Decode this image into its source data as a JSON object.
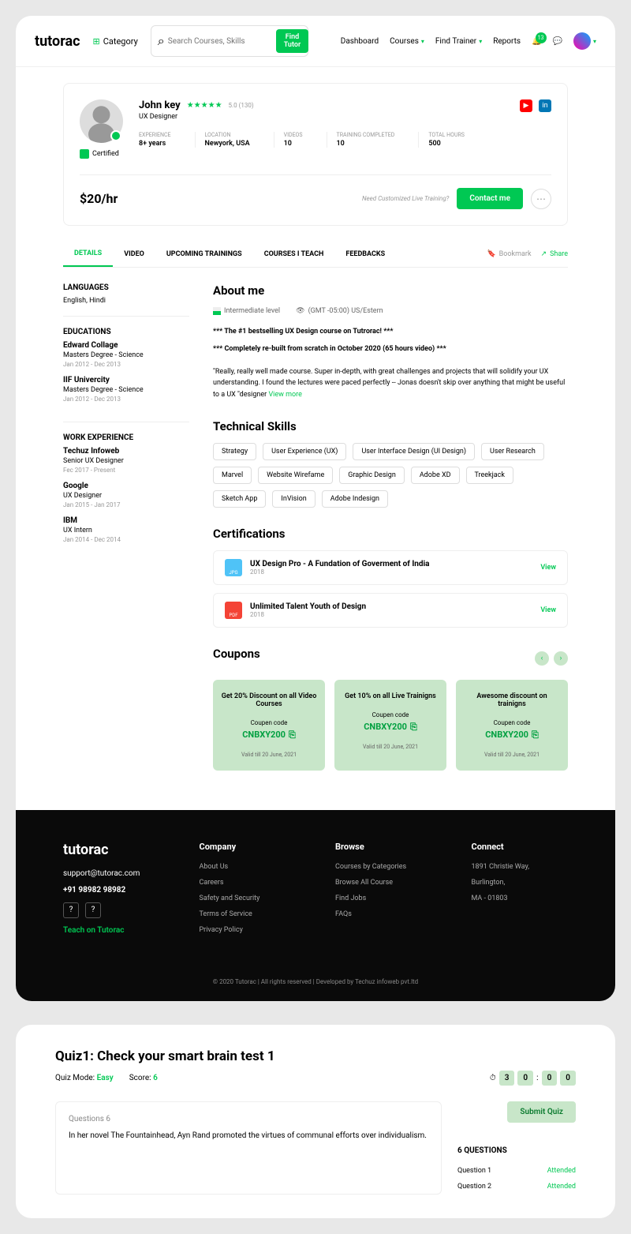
{
  "header": {
    "logo": "tutorac",
    "category": "Category",
    "search_placeholder": "Search Courses, Skills",
    "find_tutor": "Find Tutor",
    "nav": [
      "Dashboard",
      "Courses",
      "Find Trainer",
      "Reports"
    ],
    "notif_count": "13"
  },
  "profile": {
    "name": "John key",
    "rating": "5.0 (130)",
    "role": "UX Designer",
    "certified": "Certified",
    "stats": [
      {
        "label": "EXPERIENCE",
        "value": "8+ years"
      },
      {
        "label": "LOCATION",
        "value": "Newyork, USA"
      },
      {
        "label": "VIDEOS",
        "value": "10"
      },
      {
        "label": "TRAINING COMPLETED",
        "value": "10"
      },
      {
        "label": "TOTAL HOURS",
        "value": "500"
      }
    ],
    "price": "$20/hr",
    "custom_text": "Need Customized Live Training?",
    "contact": "Contact me"
  },
  "tabs": [
    "DETAILS",
    "VIDEO",
    "UPCOMING TRAININGS",
    "COURSES I TEACH",
    "FEEDBACKS"
  ],
  "bookmark": "Bookmark",
  "share": "Share",
  "sidebar": {
    "languages": {
      "title": "LANGUAGES",
      "value": "English, Hindi"
    },
    "educations": {
      "title": "EDUCATIONS",
      "items": [
        {
          "title": "Edward Collage",
          "sub": "Masters Degree - Science",
          "date": "Jan 2012 - Dec 2013"
        },
        {
          "title": "IIF Univercity",
          "sub": "Masters Degree - Science",
          "date": "Jan 2012 - Dec 2013"
        }
      ]
    },
    "work": {
      "title": "WORK EXPERIENCE",
      "items": [
        {
          "title": "Techuz Infoweb",
          "sub": "Senior UX Designer",
          "date": "Fec 2017 - Present"
        },
        {
          "title": "Google",
          "sub": "UX Designer",
          "date": "Jan 2015 - Jan 2017"
        },
        {
          "title": "IBM",
          "sub": "UX Intern",
          "date": "Jan 2014 - Dec 2014"
        }
      ]
    }
  },
  "about": {
    "title": "About me",
    "level": "Intermediate level",
    "timezone": "(GMT -05:00) US/Estern",
    "line1": "*** The #1 bestselling UX Design course on Tutrorac! ***",
    "line2": "*** Completely re-built from scratch in October 2020 (65 hours video) ***",
    "review": "\"Really, really well made course. Super in-depth, with great challenges and projects that will solidify your UX understanding. I found the lectures were paced perfectly -- Jonas doesn't skip over anything that might be useful to a UX \"designer",
    "view_more": "View more"
  },
  "skills": {
    "title": "Technical Skills",
    "items": [
      "Strategy",
      "User Experience (UX)",
      "User Interface Design (UI Design)",
      "User Research",
      "Marvel",
      "Website Wirefame",
      "Graphic Design",
      "Adobe XD",
      "Treekjack",
      "Sketch App",
      "InVision",
      "Adobe Indesign"
    ]
  },
  "certs": {
    "title": "Certifications",
    "items": [
      {
        "type": "JPG",
        "title": "UX Design Pro - A Fundation of Goverment of India",
        "year": "2018",
        "view": "View"
      },
      {
        "type": "PDF",
        "title": "Unlimited Talent Youth of Design",
        "year": "2018",
        "view": "View"
      }
    ]
  },
  "coupons": {
    "title": "Coupons",
    "items": [
      {
        "title": "Get 20% Discount on all Video Courses",
        "label": "Coupen code",
        "code": "CNBXY200",
        "valid": "Valid till 20 June, 2021"
      },
      {
        "title": "Get 10% on all Live Trainigns",
        "label": "Coupen code",
        "code": "CNBXY200",
        "valid": "Valid till 20 June, 2021"
      },
      {
        "title": "Awesome discount on trainigns",
        "label": "Coupen code",
        "code": "CNBXY200",
        "valid": "Valid till 20 June, 2021"
      }
    ]
  },
  "footer": {
    "logo": "tutorac",
    "email": "support@tutorac.com",
    "phone": "+91 98982 98982",
    "teach": "Teach on Tutorac",
    "company": {
      "title": "Company",
      "links": [
        "About Us",
        "Careers",
        "Safety and Security",
        "Terms of Service",
        "Privacy Policy"
      ]
    },
    "browse": {
      "title": "Browse",
      "links": [
        "Courses by Categories",
        "Browse All Course",
        "Find Jobs",
        "FAQs"
      ]
    },
    "connect": {
      "title": "Connect",
      "addr1": "1891  Christie Way,",
      "addr2": "Burlington,",
      "addr3": "MA - 01803"
    },
    "copyright": "© 2020 Tutorac   |   All rights reserved   |   Developed by Techuz infoweb pvt.ltd"
  },
  "quiz": {
    "title": "Quiz1: Check your smart brain test 1",
    "mode_label": "Quiz Mode:",
    "mode": "Easy",
    "score_label": "Score:",
    "score": "6",
    "timer": [
      "3",
      "0",
      "0",
      "0"
    ],
    "q_num": "Questions 6",
    "q_text": "In her novel The Fountainhead, Ayn Rand promoted the virtues of communal efforts over individualism.",
    "submit": "Submit Quiz",
    "count_title": "6 QUESTIONS",
    "items": [
      {
        "label": "Question 1",
        "status": "Attended"
      },
      {
        "label": "Question 2",
        "status": "Attended"
      }
    ]
  }
}
